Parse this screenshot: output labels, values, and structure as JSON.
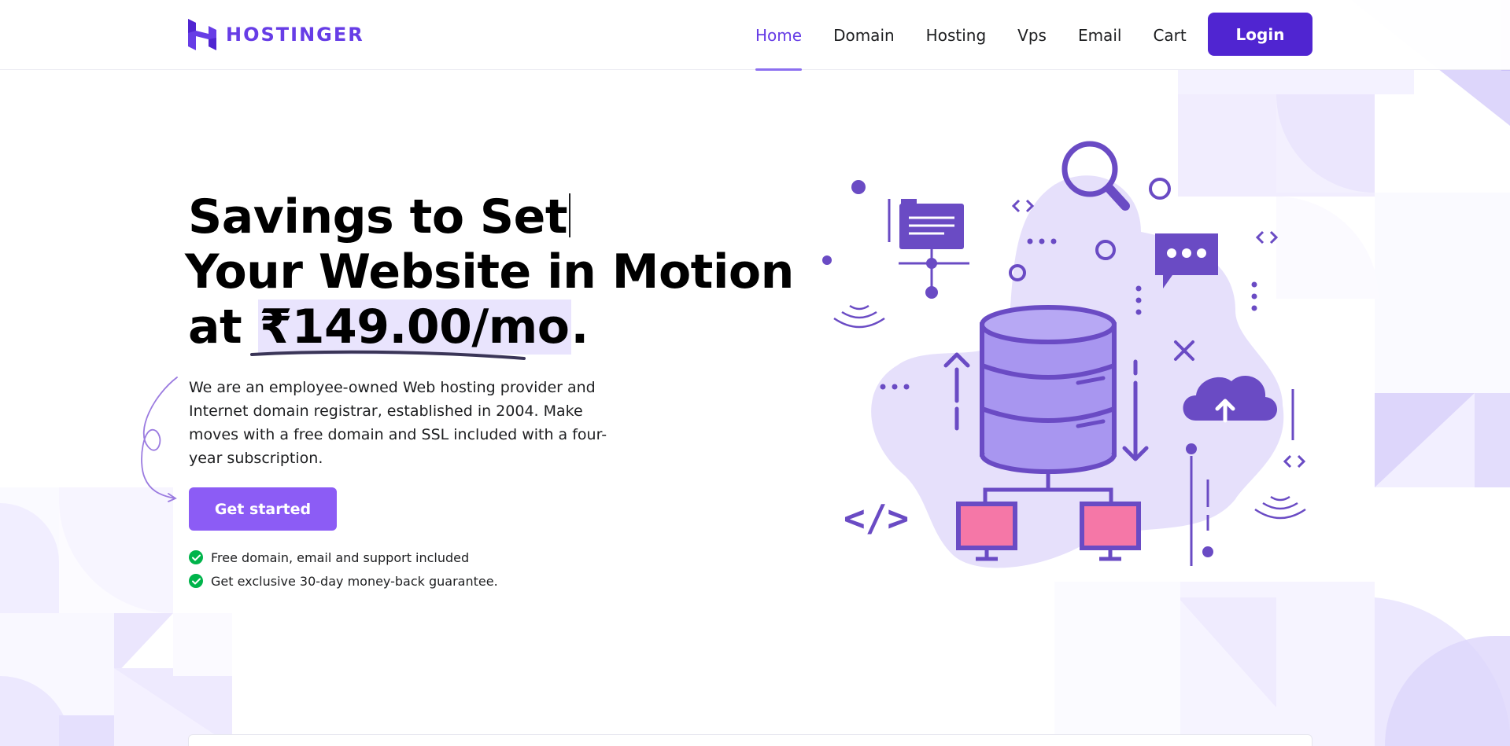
{
  "header": {
    "logo_text": "HOSTINGER",
    "nav": [
      {
        "label": "Home",
        "active": true
      },
      {
        "label": "Domain",
        "active": false
      },
      {
        "label": "Hosting",
        "active": false
      },
      {
        "label": "Vps",
        "active": false
      },
      {
        "label": "Email",
        "active": false
      },
      {
        "label": "Cart",
        "active": false
      }
    ],
    "login_label": "Login"
  },
  "hero": {
    "title_line1": "Savings to Set",
    "title_line2": "Your Website in Motion",
    "title_line3_prefix": "at ",
    "title_price": "₹149.00/mo",
    "title_line3_suffix": ".",
    "description": "We are an employee-owned Web hosting provider and Internet domain registrar, established in 2004. Make moves with a free domain and SSL included with a four-year subscription.",
    "cta_label": "Get started",
    "features": [
      "Free domain, email and support included",
      "Get exclusive 30-day money-back guarantee."
    ]
  },
  "colors": {
    "brand": "#673de6",
    "login_bg": "#5025d1",
    "cta_bg": "#8c5cf5",
    "check": "#00b44b",
    "illustration_blob": "#e6e0fb",
    "monitor_screen": "#f577a7"
  }
}
